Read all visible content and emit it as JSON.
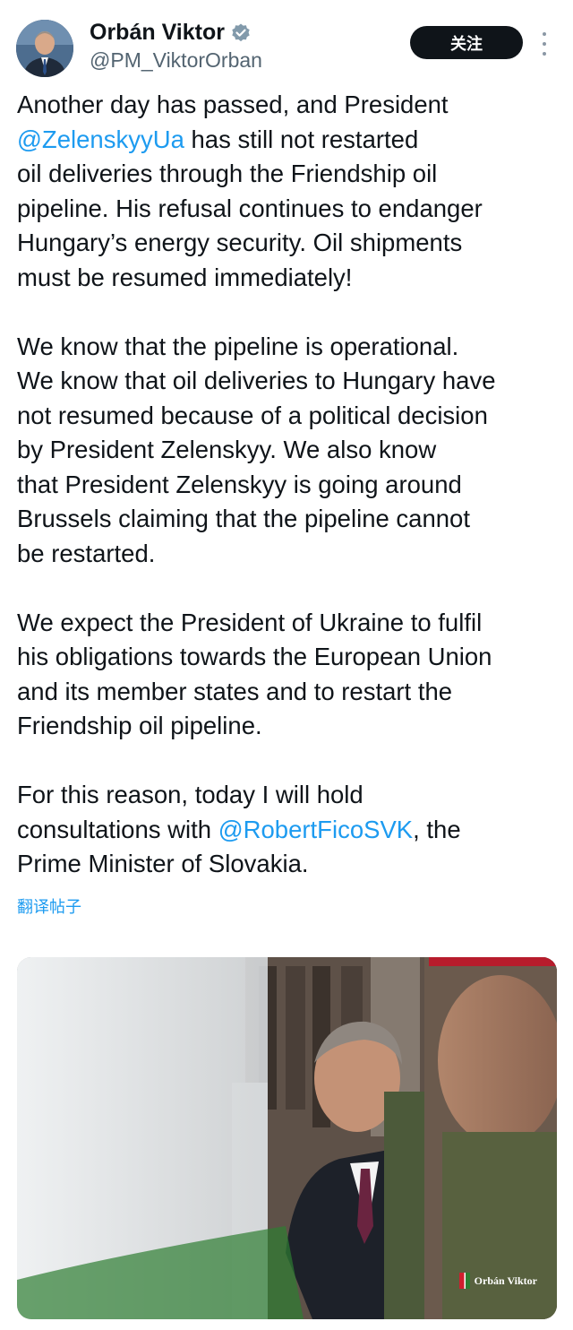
{
  "author": {
    "display_name": "Orbán Viktor",
    "handle": "@PM_ViktorOrban",
    "verified_icon": "verified-badge-icon",
    "avatar_icon": "profile-avatar"
  },
  "actions": {
    "follow_label": "关注",
    "more_icon": "more-vertical-icon"
  },
  "tweet": {
    "paragraphs": [
      [
        "Another day has passed, and President",
        "@ZelenskyyUa|has still not restarted",
        "oil deliveries through the Friendship oil",
        "pipeline. His refusal continues to endanger",
        "Hungary’s energy security. Oil shipments",
        "must be resumed immediately!"
      ],
      [
        "We know that the pipeline is operational.",
        "We know that oil deliveries to Hungary have",
        "not resumed because of a political decision",
        "by President Zelenskyy. We also know",
        "that President Zelenskyy is going around",
        "Brussels claiming that the pipeline cannot",
        "be restarted."
      ],
      [
        "We expect the President of Ukraine to fulfil",
        "his obligations towards the European Union",
        "and its member states and to restart the",
        "Friendship oil pipeline."
      ],
      [
        "For this reason, today I will hold",
        "consultations with|@RobertFicoSVK|, the",
        "Prime Minister of Slovakia."
      ]
    ],
    "mentions": [
      "@ZelenskyyUa",
      "@RobertFicoSVK"
    ],
    "translate_label": "翻译帖子"
  },
  "media": {
    "watermark_text": "Orbán Viktor"
  },
  "colors": {
    "accent": "#1d9bf0",
    "text": "#0f1419",
    "secondary_text": "#536471",
    "follow_bg": "#0f1419"
  }
}
